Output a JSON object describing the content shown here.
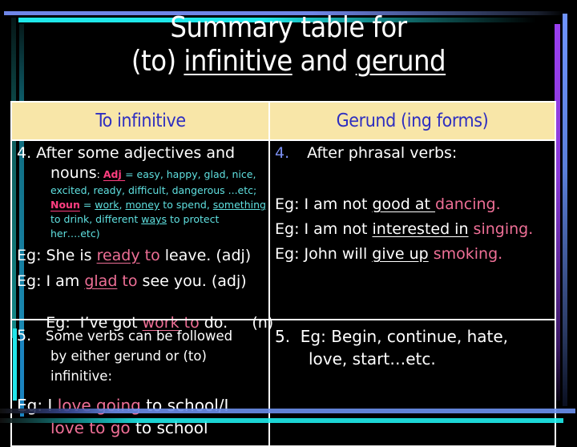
{
  "slide": {
    "title_line1": "Summary table for",
    "title_line2_prefix": "(to) ",
    "title_line2_word1": "infinitive",
    "title_line2_mid": " and ",
    "title_line2_word2": "gerund"
  },
  "table": {
    "headers": [
      "To infinitive",
      "Gerund (ing forms)"
    ],
    "infinitive_rule4": {
      "heading": "4. After some adjectives and",
      "nouns_word": "nouns",
      "colon": ": ",
      "adj_label": "Adj ",
      "adj_list_1": "= easy, happy, glad, nice,",
      "adj_list_2": "excited, ready, difficult, dangerous ...etc;",
      "noun_label": "Noun",
      "noun_eq": " = ",
      "noun_work": "work",
      "noun_sep1": ", ",
      "noun_money": "money",
      "noun_mid": " to spend, ",
      "noun_something": "something",
      "noun_line2_a": "to drink, different ",
      "noun_ways": "ways",
      "noun_line2_b": " to protect",
      "noun_line3": "her….etc)",
      "examples": [
        {
          "pre": "Eg: She is ",
          "key": "ready",
          "to": " to",
          "post": " leave. (adj)"
        },
        {
          "pre": "Eg:  I am ",
          "key": "glad",
          "to": " to",
          "post": " see you. (adj)"
        },
        {
          "pre": "Eg:  I’ve got ",
          "key": "work",
          "to": " to",
          "post": " do.     (n)"
        }
      ]
    },
    "gerund_rule4": {
      "number": "4.",
      "heading": "After phrasal verbs:",
      "examples": [
        {
          "pre": "Eg: I am not ",
          "phrase": "good at ",
          "gerund": "dancing."
        },
        {
          "pre": "Eg: I am not ",
          "phrase": "interested in",
          "gerund": " singing."
        },
        {
          "pre": "Eg: John will ",
          "phrase": "give up",
          "gerund": " smoking."
        }
      ]
    },
    "infinitive_rule5": {
      "number": "5.",
      "text_1": "Some verbs can be followed",
      "text_2": "by either gerund or (to)",
      "text_3": "infinitive:",
      "example_pre": "Eg: I ",
      "example_pink1": "love going",
      "example_mid": " to school/I",
      "example_pink2": "love to go",
      "example_post": " to school"
    },
    "gerund_rule5": {
      "line1": "5.  Eg: Begin, continue, hate,",
      "line2": "love, start…etc."
    }
  }
}
